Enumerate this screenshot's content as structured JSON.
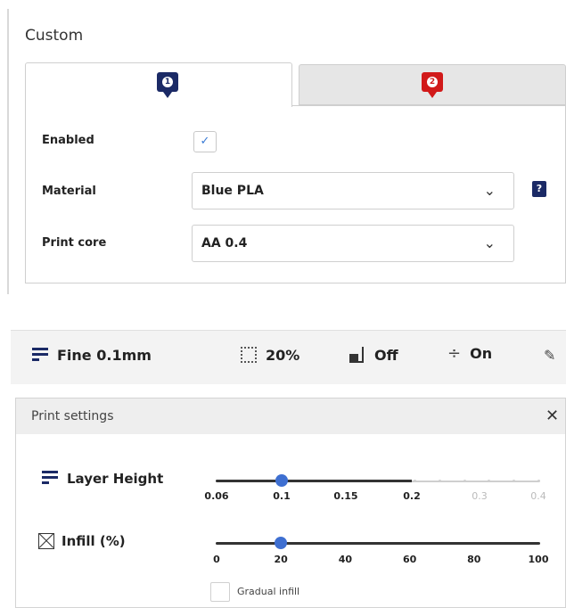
{
  "custom": {
    "title": "Custom",
    "tabs": [
      {
        "badge": "1",
        "color": "#1b2a66"
      },
      {
        "badge": "2",
        "color": "#d11919"
      }
    ],
    "enabled_label": "Enabled",
    "enabled_checked": true,
    "enabled_check_glyph": "✓",
    "material_label": "Material",
    "material_value": "Blue PLA",
    "core_label": "Print core",
    "core_value": "AA 0.4",
    "chevron": "⌄",
    "help_glyph": "?"
  },
  "toolbar": {
    "profile": "Fine 0.1mm",
    "infill": "20%",
    "support": "Off",
    "adhesion_icon": "÷",
    "adhesion": "On",
    "edit_icon": "✎"
  },
  "print_settings": {
    "title": "Print settings",
    "close_glyph": "✕",
    "layer_height_label": "Layer Height",
    "layer_ticks": [
      "0.06",
      "0.1",
      "0.15",
      "0.2",
      "0.3",
      "0.4"
    ],
    "layer_value": 0.1,
    "infill_label": "Infill (%)",
    "infill_ticks": [
      "0",
      "20",
      "40",
      "60",
      "80",
      "100"
    ],
    "infill_value": 20,
    "gradual_label": "Gradual infill",
    "gradual_checked": false
  }
}
